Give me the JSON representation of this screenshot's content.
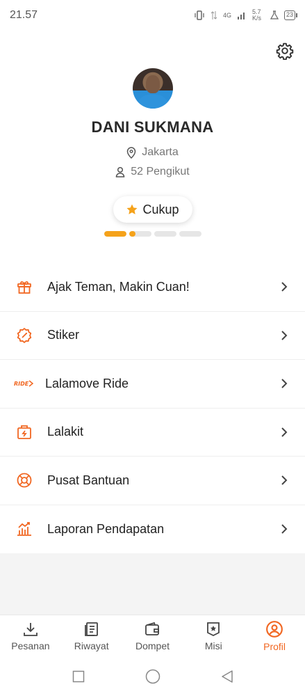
{
  "status_bar": {
    "time": "21.57",
    "network": "4G",
    "speed": "5.7 K/s",
    "battery": "23"
  },
  "profile": {
    "name": "DANI SUKMANA",
    "location": "Jakarta",
    "followers": "52 Pengikut",
    "level": "Cukup",
    "level_progress": 0.3
  },
  "menu": [
    {
      "label": "Ajak Teman, Makin Cuan!",
      "icon": "gift-icon"
    },
    {
      "label": "Stiker",
      "icon": "sticker-icon"
    },
    {
      "label": "Lalamove Ride",
      "icon": "ride-icon"
    },
    {
      "label": "Lalakit",
      "icon": "kit-bag-icon"
    },
    {
      "label": "Pusat Bantuan",
      "icon": "lifebuoy-icon"
    },
    {
      "label": "Laporan Pendapatan",
      "icon": "bar-chart-icon"
    }
  ],
  "ride_icon_text": "RIDE",
  "bottom_nav": [
    {
      "label": "Pesanan",
      "icon": "download-icon"
    },
    {
      "label": "Riwayat",
      "icon": "history-icon"
    },
    {
      "label": "Dompet",
      "icon": "wallet-icon"
    },
    {
      "label": "Misi",
      "icon": "mission-icon"
    },
    {
      "label": "Profil",
      "icon": "profile-icon",
      "active": true
    }
  ],
  "colors": {
    "accent": "#f16722",
    "star": "#f5a21a",
    "menu_icon": "#f16722"
  }
}
